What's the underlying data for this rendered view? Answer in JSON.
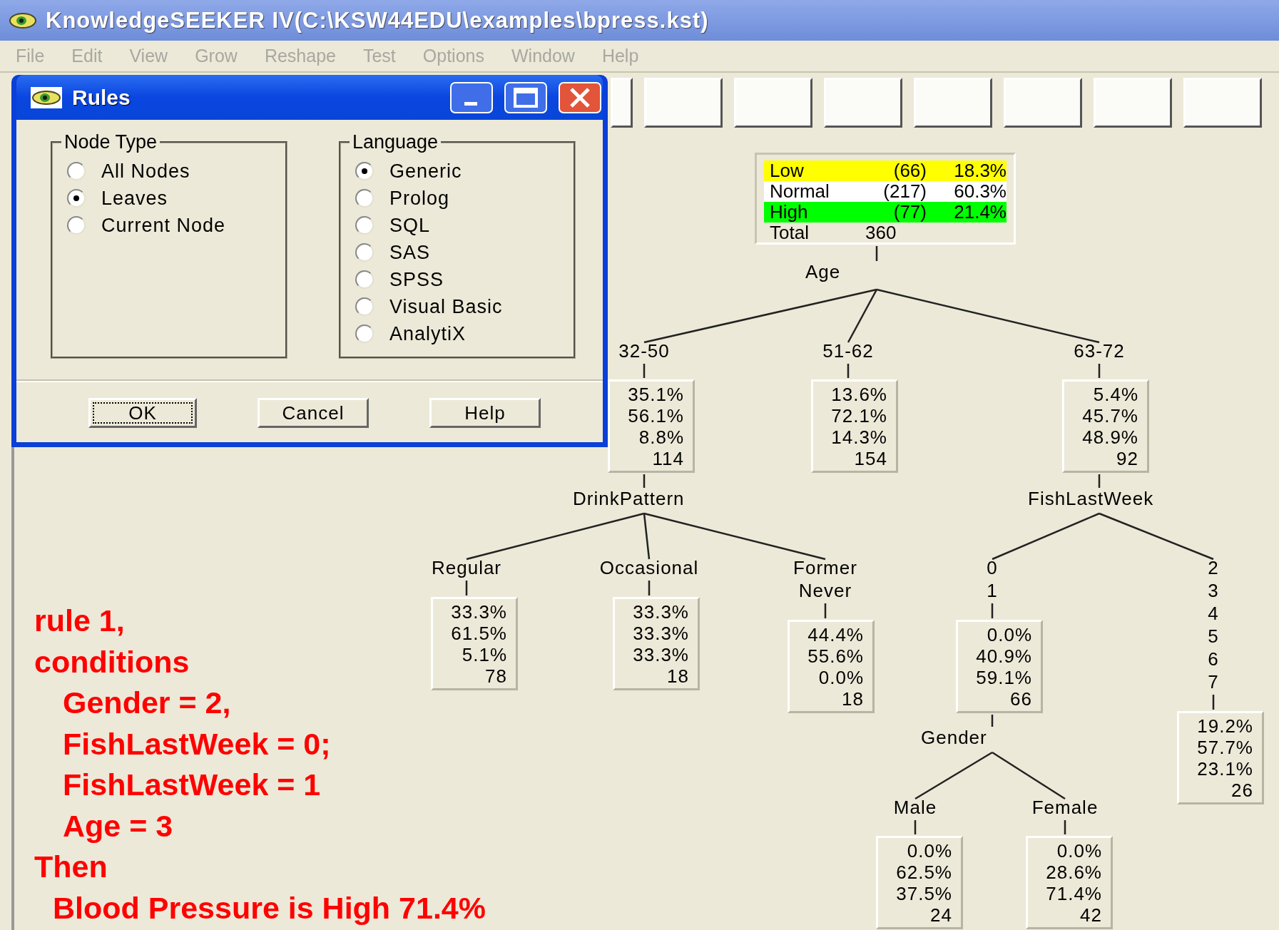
{
  "window": {
    "title": "KnowledgeSEEKER IV(C:\\KSW44EDU\\examples\\bpress.kst)"
  },
  "menu": [
    "File",
    "Edit",
    "View",
    "Grow",
    "Reshape",
    "Test",
    "Options",
    "Window",
    "Help"
  ],
  "dialog": {
    "title": "Rules",
    "groups": [
      {
        "title": "Node Type",
        "options": [
          {
            "label": "All Nodes",
            "selected": false
          },
          {
            "label": "Leaves",
            "selected": true
          },
          {
            "label": "Current Node",
            "selected": false
          }
        ]
      },
      {
        "title": "Language",
        "options": [
          {
            "label": "Generic",
            "selected": true
          },
          {
            "label": "Prolog",
            "selected": false
          },
          {
            "label": "SQL",
            "selected": false
          },
          {
            "label": "SAS",
            "selected": false
          },
          {
            "label": "SPSS",
            "selected": false
          },
          {
            "label": "Visual Basic",
            "selected": false
          },
          {
            "label": "AnalytiX",
            "selected": false
          }
        ]
      }
    ],
    "buttons": [
      {
        "label": "OK",
        "focused": true
      },
      {
        "label": "Cancel",
        "focused": false
      },
      {
        "label": "Help",
        "focused": false
      }
    ]
  },
  "tree": {
    "summary": [
      {
        "name": "Low",
        "count": "(66)",
        "percent": "18.3%",
        "color": "#ffff00"
      },
      {
        "name": "Normal",
        "count": "(217)",
        "percent": "60.3%",
        "color": "#ffffff"
      },
      {
        "name": "High",
        "count": "(77)",
        "percent": "21.4%",
        "color": "#00ff00"
      }
    ],
    "total_label": "Total",
    "total": "360",
    "split": "Age",
    "children": [
      {
        "branch": [
          "32-50"
        ],
        "values": [
          "35.1%",
          "56.1%",
          "8.8%",
          "114"
        ],
        "split": "DrinkPattern",
        "children": [
          {
            "branch": [
              "Regular"
            ],
            "values": [
              "33.3%",
              "61.5%",
              "5.1%",
              "78"
            ]
          },
          {
            "branch": [
              "Occasional"
            ],
            "values": [
              "33.3%",
              "33.3%",
              "33.3%",
              "18"
            ]
          },
          {
            "branch": [
              "Former",
              "Never"
            ],
            "values": [
              "44.4%",
              "55.6%",
              "0.0%",
              "18"
            ]
          }
        ]
      },
      {
        "branch": [
          "51-62"
        ],
        "values": [
          "13.6%",
          "72.1%",
          "14.3%",
          "154"
        ]
      },
      {
        "branch": [
          "63-72"
        ],
        "values": [
          "5.4%",
          "45.7%",
          "48.9%",
          "92"
        ],
        "split": "FishLastWeek",
        "children": [
          {
            "branch": [
              "0",
              "1"
            ],
            "values": [
              "0.0%",
              "40.9%",
              "59.1%",
              "66"
            ],
            "split": "Gender",
            "children": [
              {
                "branch": [
                  "Male"
                ],
                "values": [
                  "0.0%",
                  "62.5%",
                  "37.5%",
                  "24"
                ]
              },
              {
                "branch": [
                  "Female"
                ],
                "values": [
                  "0.0%",
                  "28.6%",
                  "71.4%",
                  "42"
                ]
              }
            ]
          },
          {
            "branch": [
              "2",
              "3",
              "4",
              "5",
              "6",
              "7"
            ],
            "values": [
              "19.2%",
              "57.7%",
              "23.1%",
              "26"
            ]
          }
        ]
      }
    ]
  },
  "annotation": [
    {
      "kind": "rule",
      "text": "rule 1,"
    },
    {
      "kind": "rule",
      "text": "conditions"
    },
    {
      "kind": "condition",
      "text": "Gender = 2,"
    },
    {
      "kind": "condition",
      "text": "FishLastWeek = 0;"
    },
    {
      "kind": "condition",
      "text": "FishLastWeek = 1"
    },
    {
      "kind": "condition",
      "text": "Age = 3"
    },
    {
      "kind": "rule",
      "text": "Then"
    },
    {
      "kind": "result",
      "text": "Blood Pressure is High 71.4%"
    }
  ]
}
